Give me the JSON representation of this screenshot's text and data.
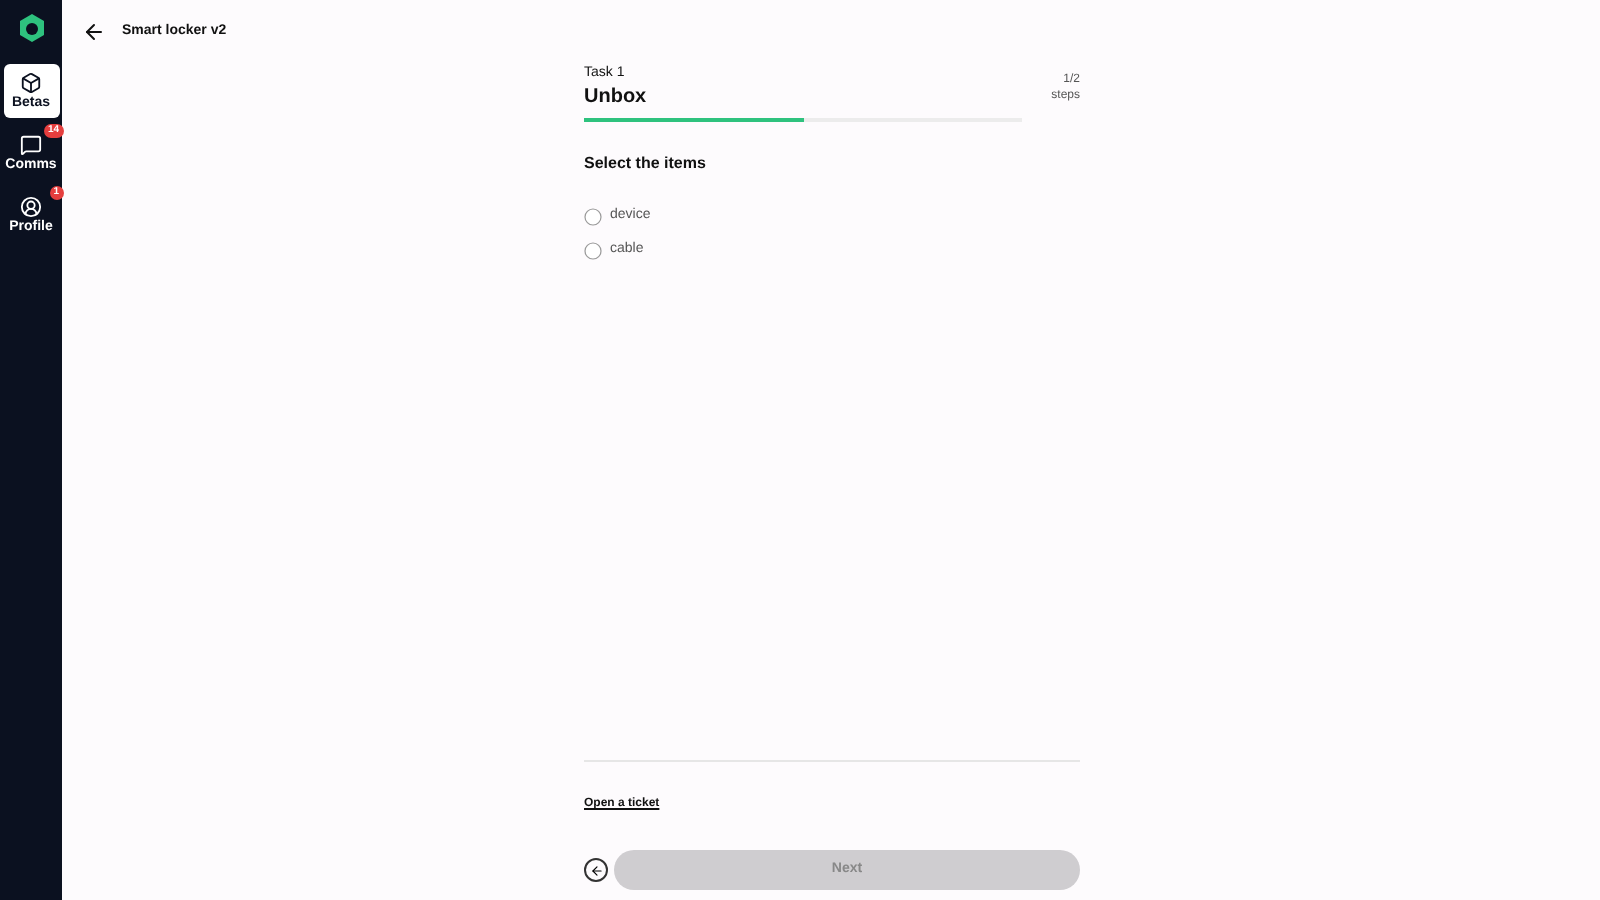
{
  "sidebar": {
    "items": [
      {
        "label": "Betas",
        "selected": true,
        "kind": "box"
      },
      {
        "label": "Comms",
        "selected": false,
        "kind": "chat",
        "badge": "14"
      },
      {
        "label": "Profile",
        "selected": false,
        "kind": "user",
        "badge": "1"
      }
    ]
  },
  "header": {
    "title": "Smart locker v2"
  },
  "task": {
    "label": "Task 1",
    "title": "Unbox",
    "level": 0.5,
    "steps": "1/2",
    "steps_label": "steps"
  },
  "question": "Select the items",
  "options": [
    {
      "label": "device",
      "selected": false
    },
    {
      "label": "cable",
      "selected": false
    }
  ],
  "footer": {
    "link": "Open a ticket",
    "next": "Next",
    "next_disabled": true
  }
}
